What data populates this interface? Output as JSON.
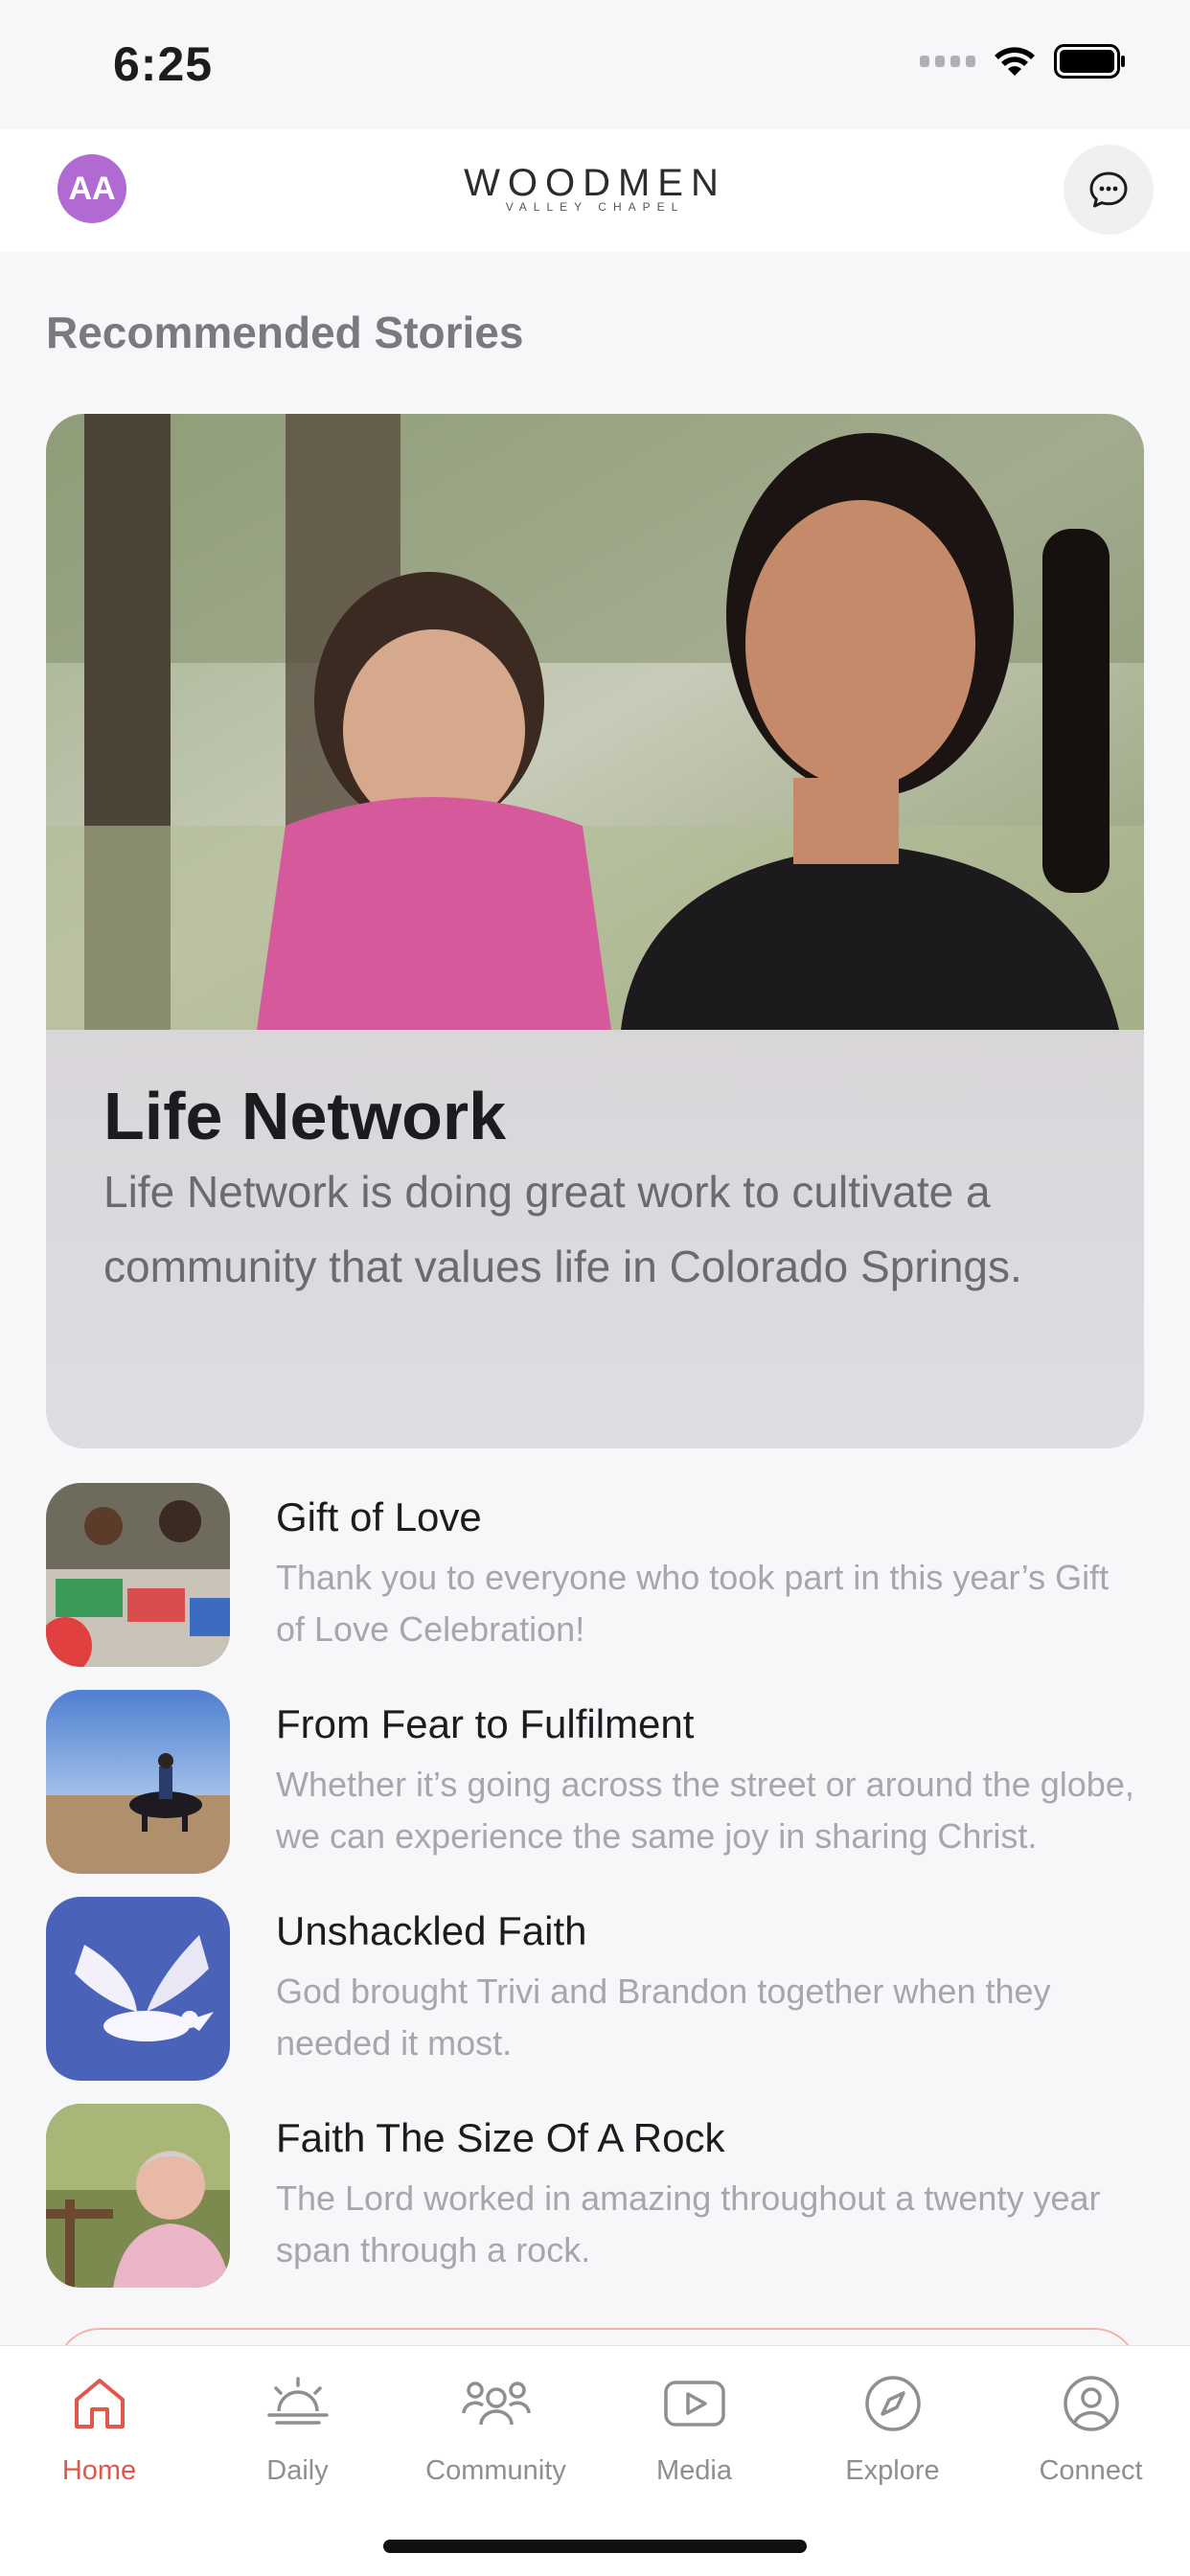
{
  "status_bar": {
    "time": "6:25"
  },
  "header": {
    "avatar_initials": "AA",
    "logo_main": "WOODMEN",
    "logo_sub": "VALLEY CHAPEL"
  },
  "section": {
    "title": "Recommended Stories"
  },
  "featured": {
    "title": "Life Network",
    "description": "Life Network is doing great work to cultivate a community that values life in Colorado Springs."
  },
  "stories": [
    {
      "title": "Gift of Love",
      "description": "Thank you to everyone who took part in this year’s Gift of Love Celebration!"
    },
    {
      "title": "From Fear to Fulfilment",
      "description": "Whether it’s going across the street or around the globe, we can experience the same joy in sharing Christ."
    },
    {
      "title": "Unshackled Faith",
      "description": "God brought Trivi and Brandon together when they needed it most."
    },
    {
      "title": "Faith The Size Of A Rock",
      "description": "The Lord worked in amazing throughout a twenty year span through a rock."
    }
  ],
  "tabs": [
    {
      "label": "Home",
      "icon": "home-icon",
      "active": true
    },
    {
      "label": "Daily",
      "icon": "sunrise-icon",
      "active": false
    },
    {
      "label": "Community",
      "icon": "people-icon",
      "active": false
    },
    {
      "label": "Media",
      "icon": "play-icon",
      "active": false
    },
    {
      "label": "Explore",
      "icon": "compass-icon",
      "active": false
    },
    {
      "label": "Connect",
      "icon": "person-icon",
      "active": false
    }
  ],
  "colors": {
    "accent": "#e2574c",
    "avatar": "#b16ad2",
    "inactive": "#8e8e93"
  }
}
